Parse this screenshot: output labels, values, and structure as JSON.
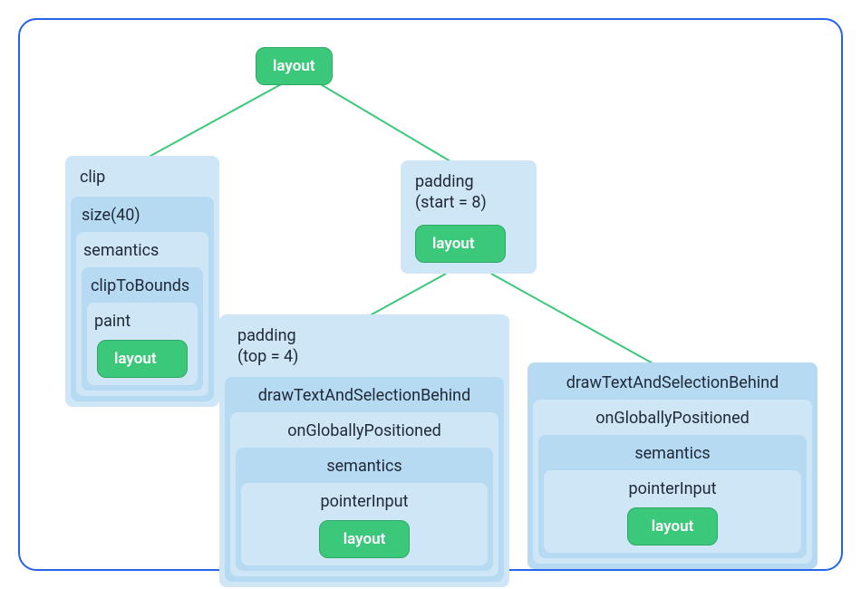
{
  "root": {
    "label": "layout"
  },
  "left": {
    "label": "clip",
    "n1": {
      "label": "size(40)"
    },
    "n2": {
      "label": "semantics"
    },
    "n3": {
      "label": "clipToBounds"
    },
    "n4": {
      "label": "paint"
    },
    "pill": "layout"
  },
  "mid": {
    "label_line1": "padding",
    "label_line2": "(start = 8)",
    "pill": "layout"
  },
  "bottomLeft": {
    "label_line1": "padding",
    "label_line2": "(top = 4)",
    "n1": {
      "label": "drawTextAndSelectionBehind"
    },
    "n2": {
      "label": "onGloballyPositioned"
    },
    "n3": {
      "label": "semantics"
    },
    "n4": {
      "label": "pointerInput"
    },
    "pill": "layout"
  },
  "bottomRight": {
    "n1": {
      "label": "drawTextAndSelectionBehind"
    },
    "n2": {
      "label": "onGloballyPositioned"
    },
    "n3": {
      "label": "semantics"
    },
    "n4": {
      "label": "pointerInput"
    },
    "pill": "layout"
  },
  "colors": {
    "accent": "#2563eb",
    "nodeBg": "#cfe6f7",
    "nestBg": "#b6daf2",
    "pillBg": "#3cc87a"
  }
}
